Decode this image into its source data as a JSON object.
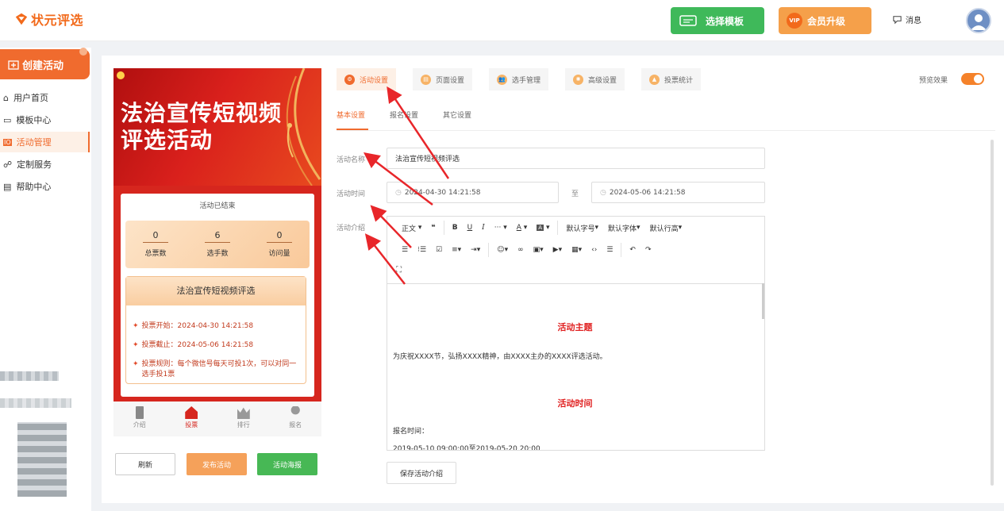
{
  "header": {
    "logo_text": "状元评选",
    "template_button": "选择模板",
    "vip_badge": "VIP",
    "vip_button": "会员升级",
    "messages_label": "消息"
  },
  "sidebar": {
    "create_label": "创建活动",
    "items": [
      {
        "label": "用户首页",
        "icon": "home-icon"
      },
      {
        "label": "模板中心",
        "icon": "template-icon"
      },
      {
        "label": "活动管理",
        "icon": "activity-icon",
        "active": true
      },
      {
        "label": "定制服务",
        "icon": "custom-icon"
      },
      {
        "label": "帮助中心",
        "icon": "help-icon"
      }
    ]
  },
  "preview": {
    "banner_title_line1": "法治宣传短视频",
    "banner_title_line2": "评选活动",
    "status": "活动已结束",
    "stats": [
      {
        "value": "0",
        "label": "总票数"
      },
      {
        "value": "6",
        "label": "选手数"
      },
      {
        "value": "0",
        "label": "访问量"
      }
    ],
    "card_title": "法治宣传短视频评选",
    "info": [
      "投票开始：2024-04-30 14:21:58",
      "投票截止：2024-05-06 14:21:58",
      "投票规则：每个微信号每天可投1次，可以对同一选手投1票"
    ],
    "tabbar": [
      "介绍",
      "投票",
      "排行",
      "报名"
    ],
    "buttons": {
      "refresh": "刷新",
      "publish": "发布活动",
      "poster": "活动海报"
    }
  },
  "tabs": [
    {
      "label": "活动设置",
      "active": true
    },
    {
      "label": "页面设置"
    },
    {
      "label": "选手管理"
    },
    {
      "label": "高级设置"
    },
    {
      "label": "投票统计"
    }
  ],
  "preview_toggle_label": "预览效果",
  "subtabs": [
    "基本设置",
    "报名设置",
    "其它设置"
  ],
  "form": {
    "name_label": "活动名称",
    "name_value": "法治宣传短视频评选",
    "time_label": "活动时间",
    "start_time": "2024-04-30 14:21:58",
    "to": "至",
    "end_time": "2024-05-06 14:21:58",
    "intro_label": "活动介绍"
  },
  "editor": {
    "toolbar": {
      "paragraph": "正文",
      "quote": "❝",
      "bold": "B",
      "underline": "U",
      "italic": "I",
      "more": "···",
      "font_color": "A",
      "bg_color": "A",
      "font_size": "默认字号",
      "font_family": "默认字体",
      "line_height": "默认行高"
    },
    "heading1": "活动主题",
    "para1": "为庆祝XXXX节，弘扬XXXX精神，由XXXX主办的XXXX评选活动。",
    "heading2": "活动时间",
    "para2": "报名时间：",
    "para3": "2019-05-10 09:00:00至2019-05-20 20:00"
  },
  "save_button": "保存活动介绍",
  "colors": {
    "accent": "#f06b2e",
    "green": "#3fb95a",
    "red": "#d6261e"
  }
}
